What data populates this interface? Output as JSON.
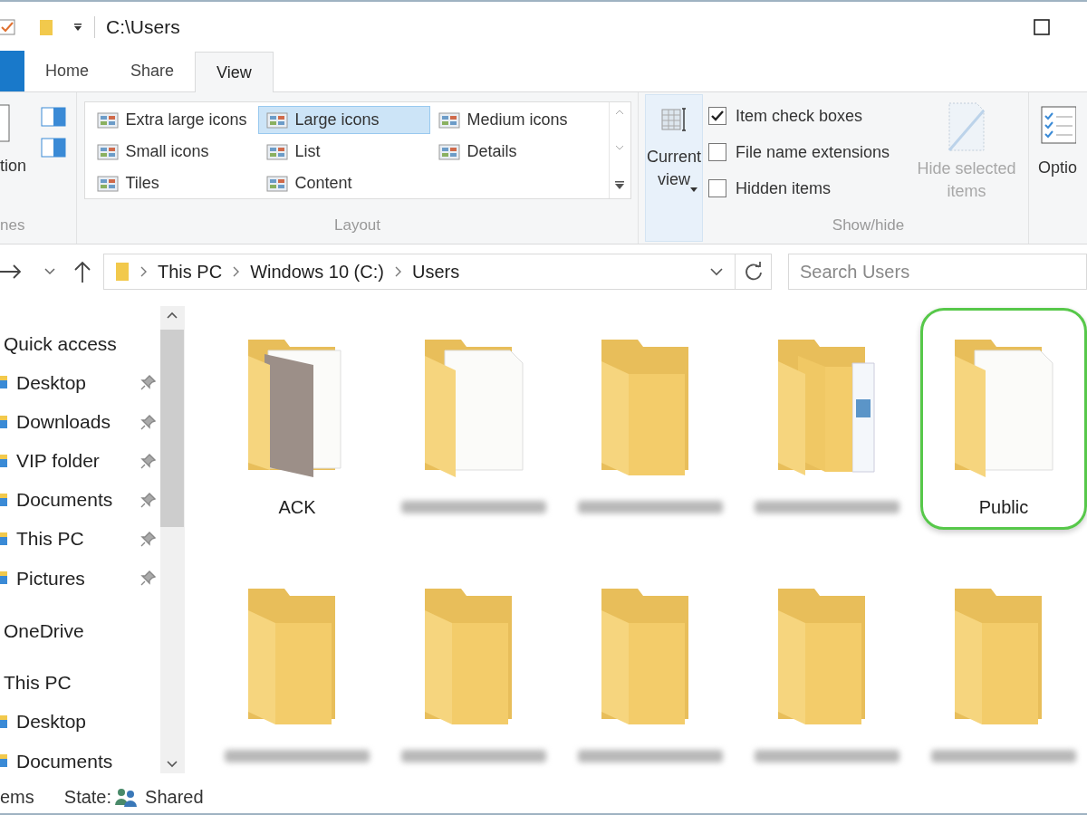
{
  "window": {
    "title": "C:\\Users"
  },
  "tabs": [
    {
      "label": "Home",
      "selected": false
    },
    {
      "label": "Share",
      "selected": false
    },
    {
      "label": "View",
      "selected": true
    }
  ],
  "ribbon": {
    "panes": {
      "button_label": "tion",
      "group_label": "nes"
    },
    "layout": {
      "group_label": "Layout",
      "options": [
        {
          "label": "Extra large icons",
          "selected": false
        },
        {
          "label": "Large icons",
          "selected": true
        },
        {
          "label": "Medium icons",
          "selected": false
        },
        {
          "label": "Small icons",
          "selected": false
        },
        {
          "label": "List",
          "selected": false
        },
        {
          "label": "Details",
          "selected": false
        },
        {
          "label": "Tiles",
          "selected": false
        },
        {
          "label": "Content",
          "selected": false
        }
      ]
    },
    "current_view": {
      "label": "Current view"
    },
    "show_hide": {
      "group_label": "Show/hide",
      "checkboxes": [
        {
          "label": "Item check boxes",
          "checked": true
        },
        {
          "label": "File name extensions",
          "checked": false
        },
        {
          "label": "Hidden items",
          "checked": false
        }
      ],
      "hide_selected": {
        "label": "Hide selected items",
        "disabled": true
      }
    },
    "options": {
      "label": "Optio"
    }
  },
  "address_bar": {
    "path": [
      "This PC",
      "Windows 10 (C:)",
      "Users"
    ],
    "search_placeholder": "Search Users"
  },
  "nav_pane": {
    "items": [
      {
        "kind": "header",
        "label": "Quick access"
      },
      {
        "kind": "item",
        "label": "Desktop",
        "pinned": true
      },
      {
        "kind": "item",
        "label": "Downloads",
        "pinned": true
      },
      {
        "kind": "item",
        "label": "VIP folder",
        "pinned": true
      },
      {
        "kind": "item",
        "label": "Documents",
        "pinned": true
      },
      {
        "kind": "item",
        "label": "This PC",
        "pinned": true
      },
      {
        "kind": "item",
        "label": "Pictures",
        "pinned": true
      },
      {
        "kind": "header",
        "label": "OneDrive"
      },
      {
        "kind": "header",
        "label": "This PC"
      },
      {
        "kind": "item",
        "label": "Desktop",
        "pinned": false
      },
      {
        "kind": "item",
        "label": "Documents",
        "pinned": false
      }
    ]
  },
  "folders": [
    {
      "kind": "photo",
      "label": "ACK",
      "highlighted": false
    },
    {
      "kind": "document",
      "blurred": true,
      "highlighted": false
    },
    {
      "kind": "plain",
      "blurred": true,
      "highlighted": false
    },
    {
      "kind": "stack",
      "blurred": true,
      "highlighted": false
    },
    {
      "kind": "document",
      "label": "Public",
      "highlighted": true
    },
    {
      "kind": "plain",
      "blurred": true,
      "highlighted": false
    },
    {
      "kind": "plain",
      "blurred": true,
      "highlighted": false
    },
    {
      "kind": "plain",
      "blurred": true,
      "highlighted": false
    },
    {
      "kind": "plain",
      "blurred": true,
      "highlighted": false
    },
    {
      "kind": "plain",
      "blurred": true,
      "highlighted": false
    }
  ],
  "status_bar": {
    "count": "ems",
    "state_label": "State:",
    "state_value": "Shared"
  }
}
